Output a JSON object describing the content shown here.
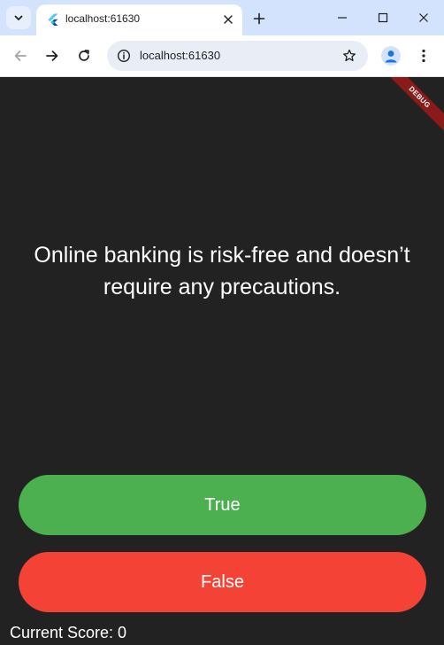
{
  "browser": {
    "tab_title": "localhost:61630",
    "address": "localhost:61630"
  },
  "app": {
    "debug_banner": "DEBUG",
    "question": "Online banking is risk-free and doesn’t require any precautions.",
    "true_label": "True",
    "false_label": "False",
    "score_text": "Current Score: 0"
  },
  "colors": {
    "true_button": "#4caf50",
    "false_button": "#f44336",
    "background": "#222222",
    "tabstrip": "#d3e3fd"
  },
  "icons": {
    "tab_search": "chevron-down-icon",
    "favicon": "flutter-icon",
    "tab_close": "close-icon",
    "new_tab": "plus-icon",
    "minimize": "minimize-icon",
    "maximize": "maximize-icon",
    "close_window": "close-icon",
    "back": "arrow-left-icon",
    "forward": "arrow-right-icon",
    "reload": "reload-icon",
    "site_info": "info-icon",
    "bookmark": "star-icon",
    "profile": "person-icon",
    "menu": "kebab-icon"
  }
}
